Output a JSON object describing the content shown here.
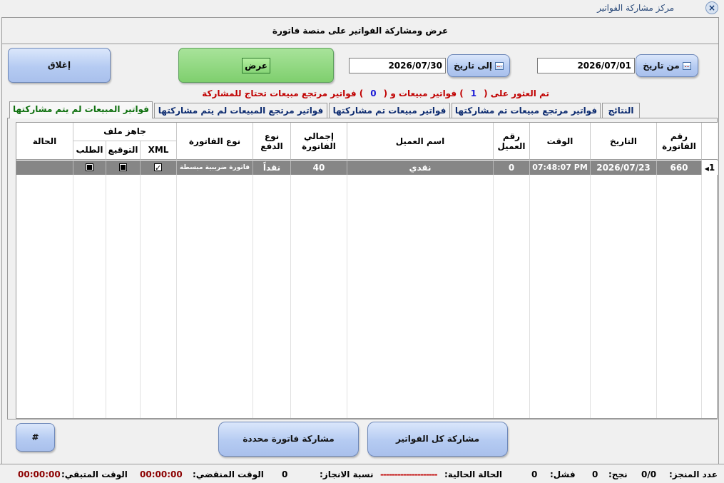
{
  "window": {
    "title": "مركز مشاركة الفواتير",
    "close_glyph": "×"
  },
  "page_title": "عرض ومشاركة الفواتير على منصة فاتورة",
  "buttons": {
    "close": "إغلاق",
    "view": "عرض",
    "to_date": "إلى تاريخ",
    "from_date": "من تاريخ",
    "hash": "#",
    "share_selected": "مشاركة فاتورة محددة",
    "share_all": "مشاركة كل الفواتير"
  },
  "dates": {
    "to": "2026/07/30",
    "from": "2026/07/01"
  },
  "found": {
    "prefix": "تم العثور على (",
    "sales_count": "1",
    "middle": ") فواتير مبيعات و (",
    "returns_count": "0",
    "suffix": ") فواتير مرتجع مبيعات تحتاج للمشاركة"
  },
  "tabs": {
    "results": "النتائج",
    "returns_shared": "فواتير مرتجع مبيعات تم مشاركتها",
    "sales_shared": "فواتير مبيعات تم مشاركتها",
    "returns_unshared": "فواتير مرتجع المبيعات لم يتم مشاركتها",
    "sales_unshared": "فواتير المبيعات لم يتم مشاركتها"
  },
  "grid": {
    "headers": {
      "invoice_no": "رقم الفاتورة",
      "date": "التاريخ",
      "time": "الوقت",
      "customer_no": "رقم العميل",
      "customer_name": "اسم العميل",
      "invoice_total": "إجمالي الفاتورة",
      "payment_type": "نوع الدفع",
      "invoice_type": "نوع الفاتورة",
      "file_ready": "جاهز ملف",
      "xml": "XML",
      "signature": "التوقيع",
      "request": "الطلب",
      "status": "الحالة"
    },
    "rows": [
      {
        "index": "1",
        "invoice_no": "660",
        "date": "2026/07/23",
        "time": "07:48:07 PM",
        "customer_no": "0",
        "customer_name": "نقدي",
        "invoice_total": "40",
        "payment_type": "نقداً",
        "invoice_type": "فاتورة ضريبية مبسطة",
        "xml": true,
        "signature": false,
        "request": false,
        "status": ""
      }
    ]
  },
  "status": {
    "done_label": "عدد المنجز:",
    "done_value": "0/0",
    "success_label": "نجح:",
    "success_value": "0",
    "fail_label": "فشل:",
    "fail_value": "0",
    "current_label": "الحالة الحالية:",
    "current_value": "--------------------",
    "progress_label": "نسبة الانجاز:",
    "progress_value": "0",
    "elapsed_label": "الوقت المنقضي:",
    "elapsed_value": "00:00:00",
    "remaining_label": "الوقت المتبقي:",
    "remaining_value": "00:00:00"
  }
}
